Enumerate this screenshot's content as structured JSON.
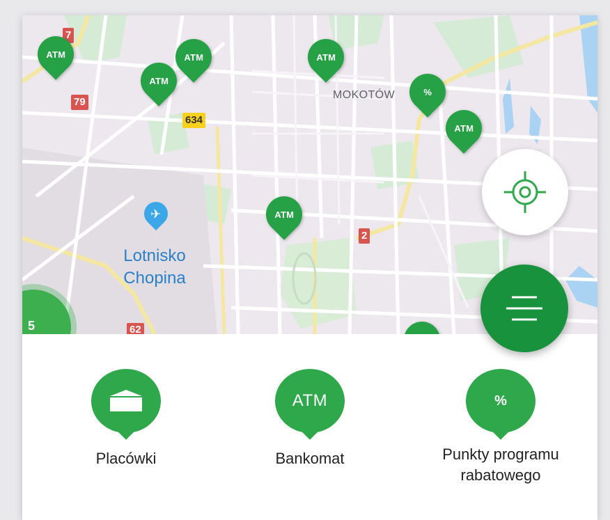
{
  "map": {
    "district_label": "MOKOTÓW",
    "airport_label_line1": "Lotnisko",
    "airport_label_line2": "Chopina",
    "airport_icon": "airplane-icon",
    "cluster_count": "5",
    "road_badges": [
      "7",
      "79",
      "634",
      "2",
      "62"
    ],
    "pins": [
      {
        "label": "ATM"
      },
      {
        "label": "ATM"
      },
      {
        "label": "ATM"
      },
      {
        "label": "ATM"
      },
      {
        "label": "%"
      },
      {
        "label": "ATM"
      },
      {
        "label": "ATM"
      }
    ]
  },
  "controls": {
    "locate_icon": "crosshair-icon",
    "menu_icon": "menu-icon"
  },
  "categories": [
    {
      "label": "Placówki",
      "icon": "envelope-icon"
    },
    {
      "label": "Bankomat",
      "icon_text": "ATM"
    },
    {
      "label_line1": "Punkty programu",
      "label_line2": "rabatowego",
      "icon_text": "%"
    }
  ],
  "colors": {
    "brand_green": "#26a146",
    "menu_green": "#18923c",
    "airport_blue": "#2a7fc9"
  }
}
